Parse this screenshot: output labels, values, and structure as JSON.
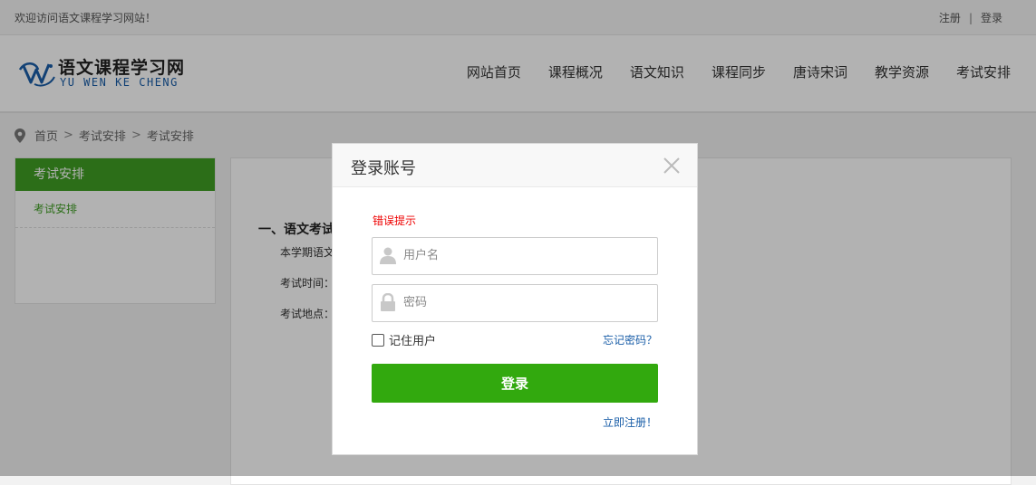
{
  "topbar": {
    "welcome": "欢迎访问语文课程学习网站！",
    "register": "注册",
    "separator": "|",
    "login": "登录"
  },
  "logo": {
    "cn": "语文课程学习网",
    "en": "YU WEN KE CHENG",
    "icon": "yw-logo-mark"
  },
  "nav": {
    "items": [
      "网站首页",
      "课程概况",
      "语文知识",
      "课程同步",
      "唐诗宋词",
      "教学资源",
      "考试安排"
    ]
  },
  "breadcrumb": {
    "icon": "location-pin-icon",
    "items": [
      "首页",
      "考试安排",
      "考试安排"
    ],
    "separator": ">"
  },
  "sidebar": {
    "title": "考试安排",
    "items": [
      "考试安排"
    ]
  },
  "content": {
    "heading": "一、语文考试",
    "line1": "本学期语文",
    "line2": "考试时间：",
    "line3": "考试地点："
  },
  "modal": {
    "title": "登录账号",
    "error": "错误提示",
    "username_placeholder": "用户名",
    "password_placeholder": "密码",
    "remember": "记住用户",
    "forgot": "忘记密码？",
    "submit": "登录",
    "register": "立即注册！"
  },
  "colors": {
    "accent_green": "#32a90e",
    "sidebar_green": "#3f9e23",
    "link_blue": "#1a5ea8",
    "error_red": "#e00000"
  }
}
